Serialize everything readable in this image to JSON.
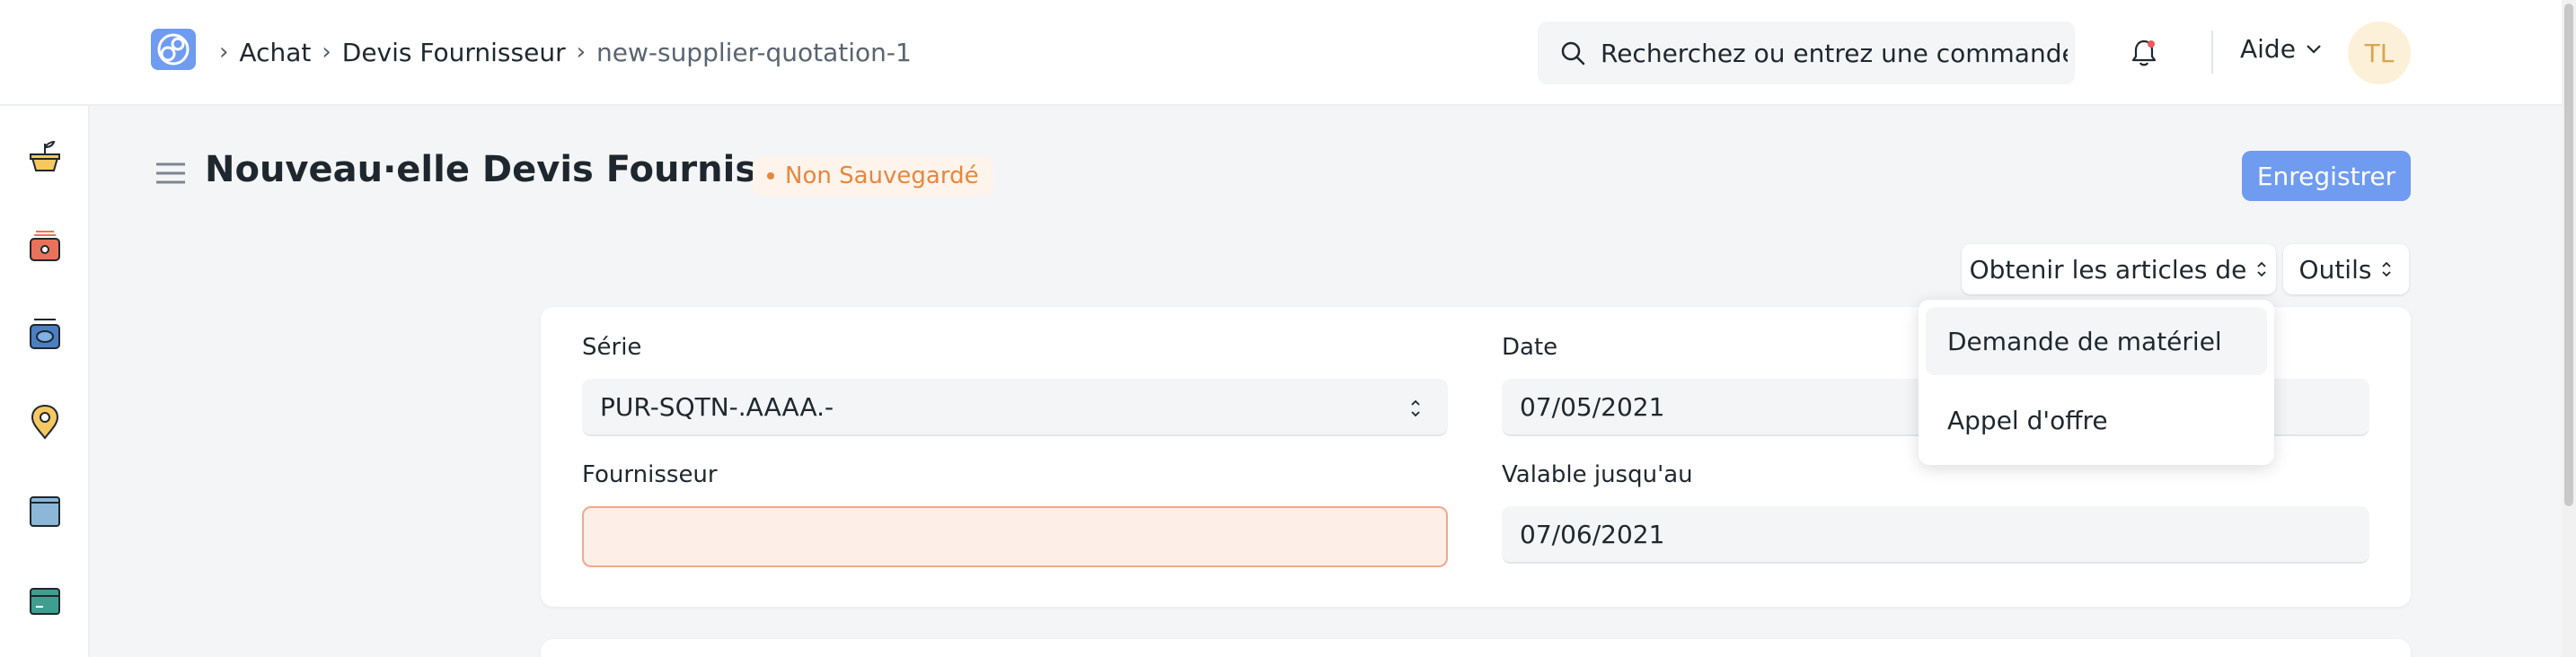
{
  "navbar": {
    "breadcrumbs": [
      "Achat",
      "Devis Fournisseur",
      "new-supplier-quotation-1"
    ],
    "search_placeholder": "Recherchez ou entrez une commande",
    "help_label": "Aide",
    "avatar_initials": "TL"
  },
  "sidebar": {
    "icons": [
      "plant-pot-icon",
      "toolbox-icon",
      "cash-register-icon",
      "location-pin-icon",
      "window-icon",
      "card-icon"
    ]
  },
  "page": {
    "title": "Nouveau·elle Devis Fournisseur",
    "status": "Non Sauvegardé",
    "save_label": "Enregistrer",
    "get_items_label": "Obtenir les articles de",
    "tools_label": "Outils"
  },
  "form": {
    "series_label": "Série",
    "series_value": "PUR-SQTN-.AAAA.-",
    "date_label": "Date",
    "date_value": "07/05/2021",
    "supplier_label": "Fournisseur",
    "supplier_value": "",
    "valid_till_label": "Valable jusqu'au",
    "valid_till_value": "07/06/2021"
  },
  "dropdown": {
    "items": [
      "Demande de matériel",
      "Appel d'offre"
    ]
  },
  "colors": {
    "primary": "#6f9bf0",
    "warning": "#e7873e",
    "invalid_bg": "#fdeee7"
  }
}
